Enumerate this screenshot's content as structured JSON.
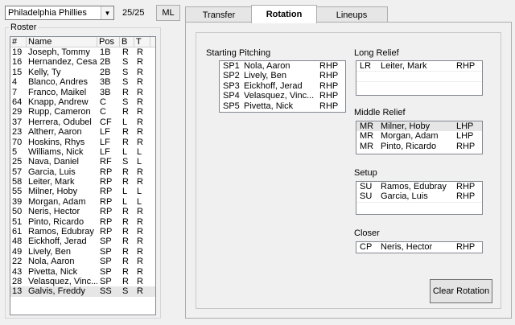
{
  "team_select": {
    "value": "Philadelphia Phillies"
  },
  "roster_count": "25/25",
  "level_button": "ML",
  "roster": {
    "legend": "Roster",
    "columns": [
      "#",
      "Name",
      "Pos",
      "B",
      "T"
    ],
    "rows": [
      {
        "num": "19",
        "name": "Joseph, Tommy",
        "pos": "1B",
        "b": "R",
        "t": "R"
      },
      {
        "num": "16",
        "name": "Hernandez, Cesar",
        "pos": "2B",
        "b": "S",
        "t": "R"
      },
      {
        "num": "15",
        "name": "Kelly, Ty",
        "pos": "2B",
        "b": "S",
        "t": "R"
      },
      {
        "num": "4",
        "name": "Blanco, Andres",
        "pos": "3B",
        "b": "S",
        "t": "R"
      },
      {
        "num": "7",
        "name": "Franco, Maikel",
        "pos": "3B",
        "b": "R",
        "t": "R"
      },
      {
        "num": "64",
        "name": "Knapp, Andrew",
        "pos": "C",
        "b": "S",
        "t": "R"
      },
      {
        "num": "29",
        "name": "Rupp, Cameron",
        "pos": "C",
        "b": "R",
        "t": "R"
      },
      {
        "num": "37",
        "name": "Herrera, Odubel",
        "pos": "CF",
        "b": "L",
        "t": "R"
      },
      {
        "num": "23",
        "name": "Altherr, Aaron",
        "pos": "LF",
        "b": "R",
        "t": "R"
      },
      {
        "num": "70",
        "name": "Hoskins, Rhys",
        "pos": "LF",
        "b": "R",
        "t": "R"
      },
      {
        "num": "5",
        "name": "Williams, Nick",
        "pos": "LF",
        "b": "L",
        "t": "L"
      },
      {
        "num": "25",
        "name": "Nava, Daniel",
        "pos": "RF",
        "b": "S",
        "t": "L"
      },
      {
        "num": "57",
        "name": "Garcia, Luis",
        "pos": "RP",
        "b": "R",
        "t": "R"
      },
      {
        "num": "58",
        "name": "Leiter, Mark",
        "pos": "RP",
        "b": "R",
        "t": "R"
      },
      {
        "num": "55",
        "name": "Milner, Hoby",
        "pos": "RP",
        "b": "L",
        "t": "L"
      },
      {
        "num": "39",
        "name": "Morgan, Adam",
        "pos": "RP",
        "b": "L",
        "t": "L"
      },
      {
        "num": "50",
        "name": "Neris, Hector",
        "pos": "RP",
        "b": "R",
        "t": "R"
      },
      {
        "num": "51",
        "name": "Pinto, Ricardo",
        "pos": "RP",
        "b": "R",
        "t": "R"
      },
      {
        "num": "61",
        "name": "Ramos, Edubray",
        "pos": "RP",
        "b": "R",
        "t": "R"
      },
      {
        "num": "48",
        "name": "Eickhoff, Jerad",
        "pos": "SP",
        "b": "R",
        "t": "R"
      },
      {
        "num": "49",
        "name": "Lively, Ben",
        "pos": "SP",
        "b": "R",
        "t": "R"
      },
      {
        "num": "22",
        "name": "Nola, Aaron",
        "pos": "SP",
        "b": "R",
        "t": "R"
      },
      {
        "num": "43",
        "name": "Pivetta, Nick",
        "pos": "SP",
        "b": "R",
        "t": "R"
      },
      {
        "num": "28",
        "name": "Velasquez, Vinc...",
        "pos": "SP",
        "b": "R",
        "t": "R"
      },
      {
        "num": "13",
        "name": "Galvis, Freddy",
        "pos": "SS",
        "b": "S",
        "t": "R"
      }
    ]
  },
  "tabs": [
    {
      "label": "Transfer"
    },
    {
      "label": "Rotation"
    },
    {
      "label": "Lineups"
    }
  ],
  "starting_pitching": {
    "label": "Starting Pitching",
    "rows": [
      {
        "code": "SP1",
        "name": "Nola, Aaron",
        "hand": "RHP"
      },
      {
        "code": "SP2",
        "name": "Lively, Ben",
        "hand": "RHP"
      },
      {
        "code": "SP3",
        "name": "Eickhoff, Jerad",
        "hand": "RHP"
      },
      {
        "code": "SP4",
        "name": "Velasquez, Vinc...",
        "hand": "RHP"
      },
      {
        "code": "SP5",
        "name": "Pivetta, Nick",
        "hand": "RHP"
      }
    ]
  },
  "long_relief": {
    "label": "Long Relief",
    "rows": [
      {
        "code": "LR",
        "name": "Leiter, Mark",
        "hand": "RHP"
      }
    ]
  },
  "middle_relief": {
    "label": "Middle Relief",
    "rows": [
      {
        "code": "MR",
        "name": "Milner, Hoby",
        "hand": "LHP"
      },
      {
        "code": "MR",
        "name": "Morgan, Adam",
        "hand": "LHP"
      },
      {
        "code": "MR",
        "name": "Pinto, Ricardo",
        "hand": "RHP"
      }
    ]
  },
  "setup": {
    "label": "Setup",
    "rows": [
      {
        "code": "SU",
        "name": "Ramos, Edubray",
        "hand": "RHP"
      },
      {
        "code": "SU",
        "name": "Garcia, Luis",
        "hand": "RHP"
      }
    ]
  },
  "closer": {
    "label": "Closer",
    "rows": [
      {
        "code": "CP",
        "name": "Neris, Hector",
        "hand": "RHP"
      }
    ]
  },
  "clear_button": "Clear Rotation"
}
